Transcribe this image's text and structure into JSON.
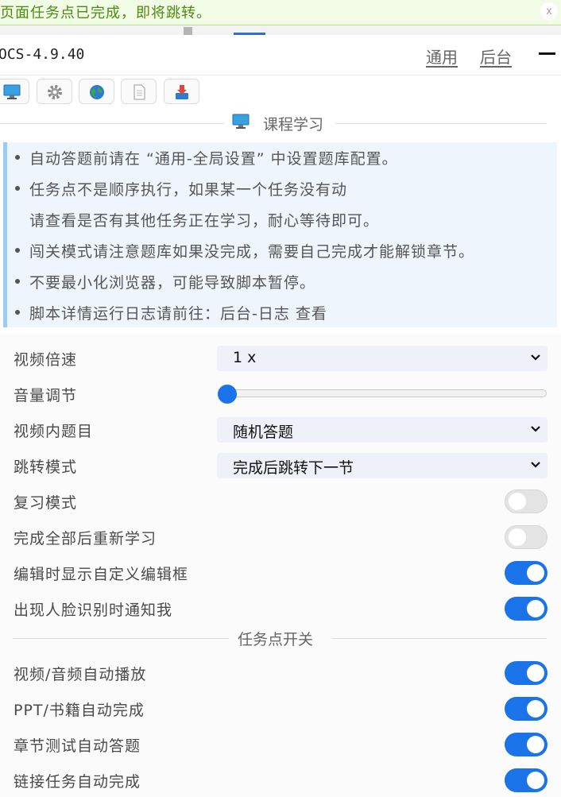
{
  "notice": {
    "text": "页面任务点已完成，即将跳转。",
    "close_label": "x"
  },
  "header": {
    "title": "OCS-4.9.40",
    "nav": [
      "通用",
      "后台"
    ],
    "minimize_icon": "minus-icon"
  },
  "toolbar": {
    "buttons": [
      "monitor-icon",
      "gear-icon",
      "globe-icon",
      "document-icon",
      "download-tray-icon"
    ]
  },
  "section_course": {
    "label": "课程学习",
    "icon": "monitor-icon"
  },
  "tips": [
    "自动答题前请在 “通用-全局设置” 中设置题库配置。",
    "任务点不是顺序执行，如果某一个任务没有动",
    "请查看是否有其他任务正在学习，耐心等待即可。",
    "闯关模式请注意题库如果没完成，需要自己完成才能解锁章节。",
    "不要最小化浏览器，可能导致脚本暂停。",
    "脚本详情运行日志请前往：后台-日志  查看"
  ],
  "settings": {
    "playback_rate": {
      "label": "视频倍速",
      "value": "1 x"
    },
    "volume": {
      "label": "音量调节",
      "level": 0
    },
    "video_question": {
      "label": "视频内题目",
      "value": "随机答题"
    },
    "jump_mode": {
      "label": "跳转模式",
      "value": "完成后跳转下一节"
    },
    "review_mode": {
      "label": "复习模式",
      "on": false
    },
    "restudy": {
      "label": "完成全部后重新学习",
      "on": false
    },
    "custom_editor": {
      "label": "编辑时显示自定义编辑框",
      "on": true
    },
    "face_notify": {
      "label": "出现人脸识别时通知我",
      "on": true
    }
  },
  "section_tasks": {
    "label": "任务点开关"
  },
  "tasks": {
    "video_audio": {
      "label": "视频/音频自动播放",
      "on": true
    },
    "ppt_book": {
      "label": "PPT/书籍自动完成",
      "on": true
    },
    "chapter_test": {
      "label": "章节测试自动答题",
      "on": true
    },
    "link_task": {
      "label": "链接任务自动完成",
      "on": true
    }
  },
  "colors": {
    "accent": "#1a73e8",
    "notice_bg": "#f1fbe6",
    "notice_text": "#4f8a10",
    "info_bg": "#eef5fc",
    "info_border": "#9ccbf5"
  }
}
